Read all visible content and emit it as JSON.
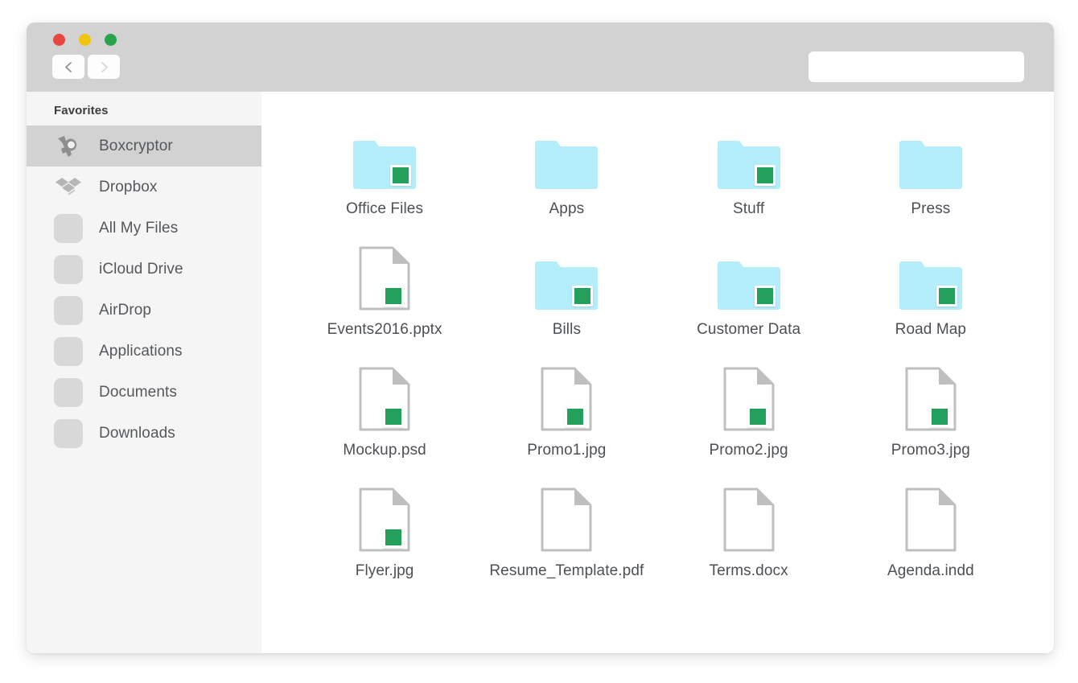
{
  "window": {
    "titlebar": {
      "traffic_lights": [
        {
          "name": "close-button",
          "color": "#e8473f"
        },
        {
          "name": "minimize-button",
          "color": "#f1c40f"
        },
        {
          "name": "maximize-button",
          "color": "#2aa44a"
        }
      ],
      "back_button_icon": "chevron-left-icon",
      "forward_button_icon": "chevron-right-icon",
      "search": {
        "value": "",
        "placeholder": ""
      }
    }
  },
  "sidebar": {
    "header": "Favorites",
    "items": [
      {
        "label": "Boxcryptor",
        "icon": "boxcryptor-icon",
        "selected": true
      },
      {
        "label": "Dropbox",
        "icon": "dropbox-icon",
        "selected": false
      },
      {
        "label": "All My Files",
        "icon": "folder-placeholder-icon",
        "selected": false
      },
      {
        "label": "iCloud Drive",
        "icon": "folder-placeholder-icon",
        "selected": false
      },
      {
        "label": "AirDrop",
        "icon": "folder-placeholder-icon",
        "selected": false
      },
      {
        "label": "Applications",
        "icon": "folder-placeholder-icon",
        "selected": false
      },
      {
        "label": "Documents",
        "icon": "folder-placeholder-icon",
        "selected": false
      },
      {
        "label": "Downloads",
        "icon": "folder-placeholder-icon",
        "selected": false
      }
    ]
  },
  "content": {
    "items": [
      {
        "label": "Office Files",
        "type": "folder",
        "encrypted": true
      },
      {
        "label": "Apps",
        "type": "folder",
        "encrypted": false
      },
      {
        "label": "Stuff",
        "type": "folder",
        "encrypted": true
      },
      {
        "label": "Press",
        "type": "folder",
        "encrypted": false
      },
      {
        "label": "Events2016.pptx",
        "type": "document",
        "encrypted": true
      },
      {
        "label": "Bills",
        "type": "folder",
        "encrypted": true
      },
      {
        "label": "Customer Data",
        "type": "folder",
        "encrypted": true
      },
      {
        "label": "Road Map",
        "type": "folder",
        "encrypted": true
      },
      {
        "label": "Mockup.psd",
        "type": "document",
        "encrypted": true
      },
      {
        "label": "Promo1.jpg",
        "type": "document",
        "encrypted": true
      },
      {
        "label": "Promo2.jpg",
        "type": "document",
        "encrypted": true
      },
      {
        "label": "Promo3.jpg",
        "type": "document",
        "encrypted": true
      },
      {
        "label": "Flyer.jpg",
        "type": "document",
        "encrypted": true
      },
      {
        "label": "Resume_Template.pdf",
        "type": "document",
        "encrypted": false
      },
      {
        "label": "Terms.docx",
        "type": "document",
        "encrypted": false
      },
      {
        "label": "Agenda.indd",
        "type": "document",
        "encrypted": false
      }
    ]
  },
  "colors": {
    "folder": "#b4eefb",
    "badge_green": "#22a05c",
    "titlebar": "#d2d2d2",
    "sidebar": "#f5f5f5",
    "selection": "#d2d2d2"
  }
}
